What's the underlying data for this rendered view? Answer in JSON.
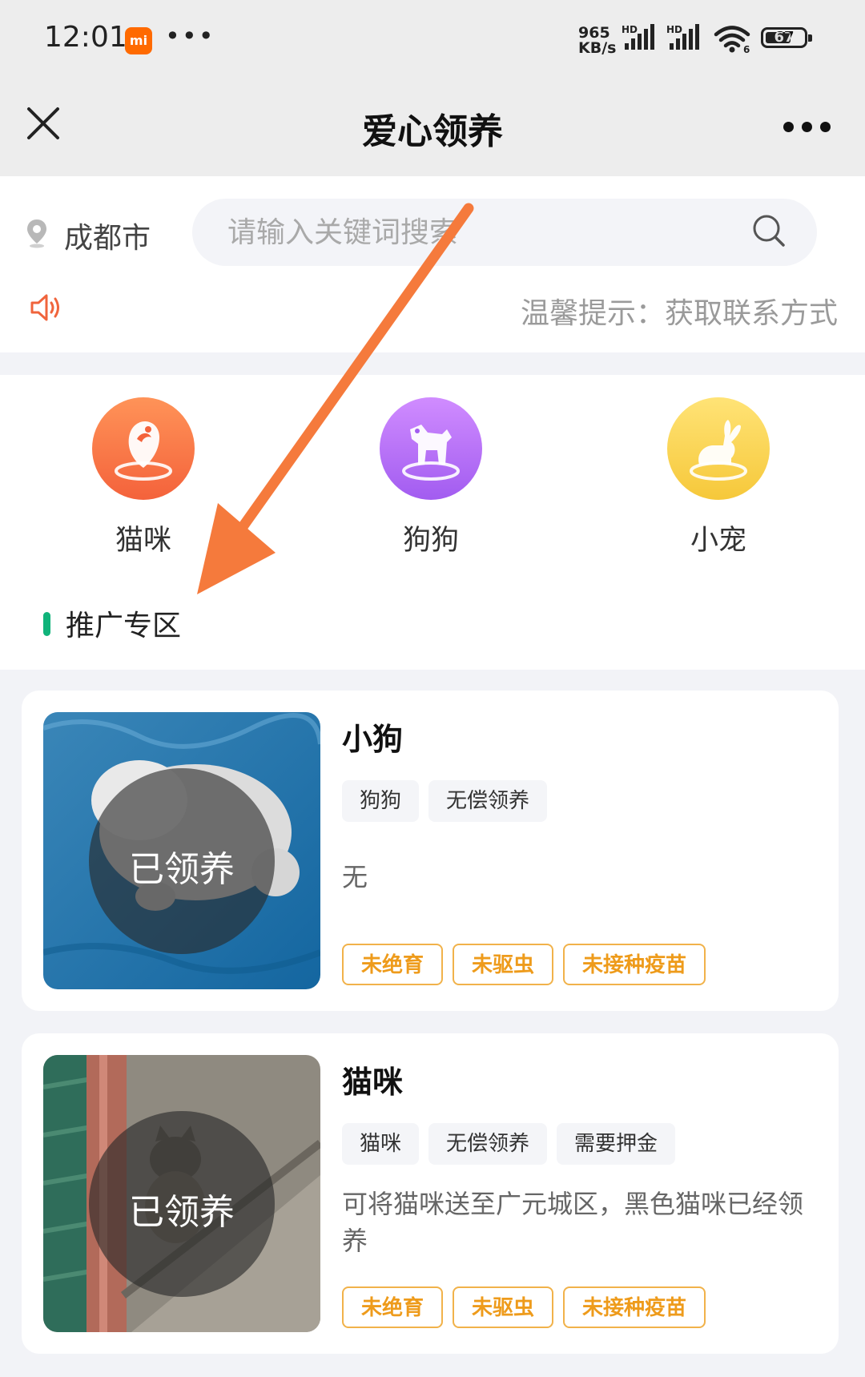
{
  "status_bar": {
    "time": "12:01",
    "mi_badge": "mi",
    "dots": "•••",
    "net_speed_value": "965",
    "net_speed_unit": "KB/s",
    "hd1": "HD",
    "hd2": "HD",
    "wifi_badge": "6",
    "battery": "67",
    "battery_percent": 67
  },
  "titlebar": {
    "title": "爱心领养"
  },
  "header": {
    "city": "成都市",
    "search_placeholder": "请输入关键词搜索",
    "notice": "温馨提示：获取联系方式"
  },
  "categories": [
    {
      "label": "猫咪",
      "icon": "cat-icon",
      "color_from": "#ff9358",
      "color_to": "#f4623b"
    },
    {
      "label": "狗狗",
      "icon": "dog-icon",
      "color_from": "#d08cff",
      "color_to": "#a25cf0"
    },
    {
      "label": "小宠",
      "icon": "rabbit-icon",
      "color_from": "#ffe376",
      "color_to": "#f6c83a"
    }
  ],
  "promo": {
    "title": "推广专区"
  },
  "listings": [
    {
      "name": "小狗",
      "overlay": "已领养",
      "tags": [
        "狗狗",
        "无偿领养"
      ],
      "desc": "无",
      "status_tags": [
        "未绝育",
        "未驱虫",
        "未接种疫苗"
      ]
    },
    {
      "name": "猫咪",
      "overlay": "已领养",
      "tags": [
        "猫咪",
        "无偿领养",
        "需要押金"
      ],
      "desc": "可将猫咪送至广元城区，黑色猫咪已经领养",
      "status_tags": [
        "未绝育",
        "未驱虫",
        "未接种疫苗"
      ]
    }
  ],
  "colors": {
    "accent_green": "#10b37a",
    "status_tag_orange": "#ee9b1b",
    "annotation_arrow": "#f57a3c"
  }
}
